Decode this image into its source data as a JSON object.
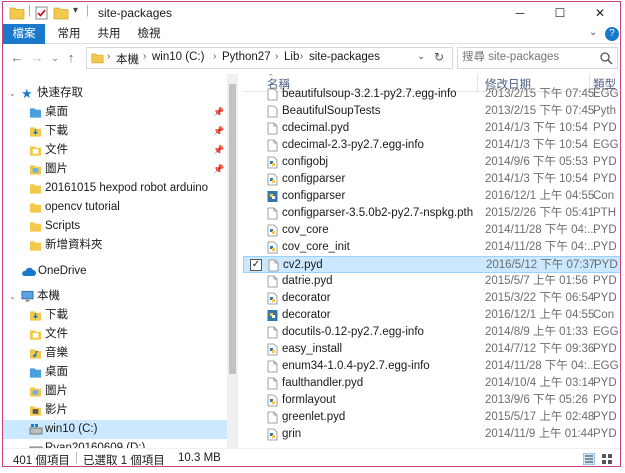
{
  "window": {
    "title": "site-packages"
  },
  "titlebar": {
    "minimize": "─",
    "maximize": "☐",
    "close": "✕"
  },
  "ribbon": {
    "tabs": [
      "檔案",
      "常用",
      "共用",
      "檢視"
    ],
    "help": "?"
  },
  "address": {
    "crumbs": [
      "本機",
      "win10 (C:)",
      "Python27",
      "Lib",
      "site-packages"
    ],
    "dropdown": "⌄",
    "refresh": "↻"
  },
  "search": {
    "placeholder": "搜尋 site-packages"
  },
  "navpane": {
    "quick_access": "快速存取",
    "pinned": [
      "桌面",
      "下載",
      "文件",
      "圖片"
    ],
    "folders": [
      "20161015 hexpod robot arduino",
      "opencv tutorial",
      "Scripts",
      "新增資料夾"
    ],
    "onedrive": "OneDrive",
    "this_pc": "本機",
    "pc_items": [
      "下載",
      "文件",
      "音樂",
      "桌面",
      "圖片",
      "影片"
    ],
    "drives": [
      "win10 (C:)",
      "Ryan20160609 (D:)"
    ]
  },
  "columns": {
    "name": "名稱",
    "date": "修改日期",
    "type": "類型"
  },
  "files": [
    {
      "name": "beautifulsoup-3.2.1-py2.7.egg-info",
      "date": "2013/2/15 下午 07:45",
      "type": "EGG",
      "icon": "folder"
    },
    {
      "name": "BeautifulSoupTests",
      "date": "2013/2/15 下午 07:45",
      "type": "Pyth",
      "icon": "folder"
    },
    {
      "name": "cdecimal.pyd",
      "date": "2014/1/3 下午 10:54",
      "type": "PYD",
      "icon": "file"
    },
    {
      "name": "cdecimal-2.3-py2.7.egg-info",
      "date": "2014/1/3 下午 10:54",
      "type": "EGG",
      "icon": "file"
    },
    {
      "name": "configobj",
      "date": "2014/9/6 下午 05:53",
      "type": "PYD",
      "icon": "python"
    },
    {
      "name": "configparser",
      "date": "2014/1/3 下午 10:54",
      "type": "PYD",
      "icon": "python"
    },
    {
      "name": "configparser",
      "date": "2016/12/1 上午 04:55",
      "type": "Con",
      "icon": "pyc"
    },
    {
      "name": "configparser-3.5.0b2-py2.7-nspkg.pth",
      "date": "2015/2/26 下午 05:41",
      "type": "PTH",
      "icon": "file"
    },
    {
      "name": "cov_core",
      "date": "2014/11/28 下午 04:...",
      "type": "PYD",
      "icon": "python"
    },
    {
      "name": "cov_core_init",
      "date": "2014/11/28 下午 04:...",
      "type": "PYD",
      "icon": "python"
    },
    {
      "name": "cv2.pyd",
      "date": "2016/5/12 下午 07:37",
      "type": "PYD",
      "icon": "file",
      "selected": true
    },
    {
      "name": "datrie.pyd",
      "date": "2015/5/7 上午 01:56",
      "type": "PYD",
      "icon": "file"
    },
    {
      "name": "decorator",
      "date": "2015/3/22 下午 06:54",
      "type": "PYD",
      "icon": "python"
    },
    {
      "name": "decorator",
      "date": "2016/12/1 上午 04:55",
      "type": "Con",
      "icon": "pyc"
    },
    {
      "name": "docutils-0.12-py2.7.egg-info",
      "date": "2014/8/9 上午 01:33",
      "type": "EGG",
      "icon": "file"
    },
    {
      "name": "easy_install",
      "date": "2014/7/12 下午 09:36",
      "type": "PYD",
      "icon": "python"
    },
    {
      "name": "enum34-1.0.4-py2.7.egg-info",
      "date": "2014/11/28 下午 04:...",
      "type": "EGG",
      "icon": "file"
    },
    {
      "name": "faulthandler.pyd",
      "date": "2014/10/4 上午 03:14",
      "type": "PYD",
      "icon": "file"
    },
    {
      "name": "formlayout",
      "date": "2013/9/6 下午 05:26",
      "type": "PYD",
      "icon": "python"
    },
    {
      "name": "greenlet.pyd",
      "date": "2015/5/17 上午 02:48",
      "type": "PYD",
      "icon": "file"
    },
    {
      "name": "grin",
      "date": "2014/11/9 上午 01:44",
      "type": "PYD",
      "icon": "python"
    }
  ],
  "status": {
    "count": "401 個項目",
    "selected": "已選取 1 個項目",
    "size": "10.3 MB"
  },
  "colors": {
    "accent": "#1979ca",
    "selection": "#cce8ff",
    "folder": "#f2c94c",
    "border": "#c9437a"
  }
}
